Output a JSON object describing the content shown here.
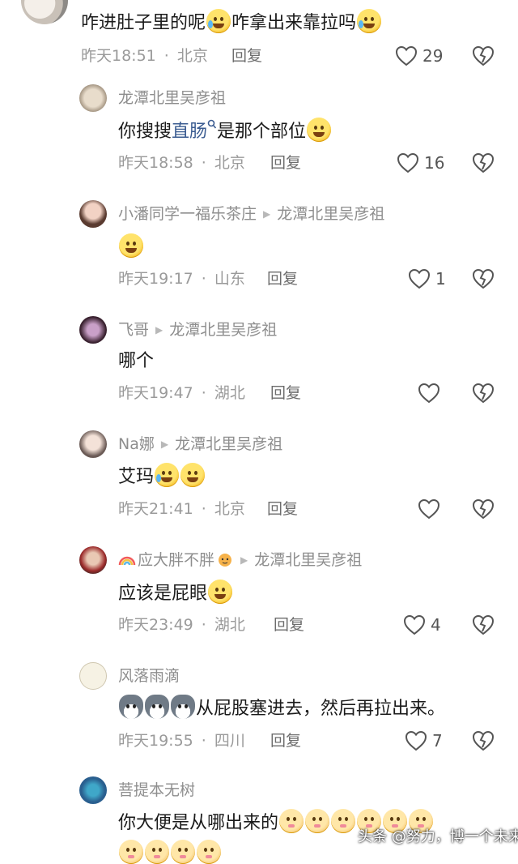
{
  "top_comment": {
    "text_a": "咋进肚子里的呢",
    "text_b": "咋拿出来靠拉吗",
    "time": "昨天18:51",
    "location": "北京",
    "reply_label": "回复",
    "likes": "29"
  },
  "replies": [
    {
      "name": "龙潭北里吴彦祖",
      "reply_to": "",
      "text_a": "你搜搜",
      "link": "直肠",
      "text_b": "是那个部位",
      "time": "昨天18:58",
      "location": "北京",
      "reply_label": "回复",
      "likes": "16"
    },
    {
      "name": "小潘同学一福乐茶庄",
      "reply_to": "龙潭北里吴彦祖",
      "time": "昨天19:17",
      "location": "山东",
      "reply_label": "回复",
      "likes": "1"
    },
    {
      "name": "飞哥",
      "reply_to": "龙潭北里吴彦祖",
      "text": "哪个",
      "time": "昨天19:47",
      "location": "湖北",
      "reply_label": "回复",
      "likes": ""
    },
    {
      "name": "Na娜",
      "reply_to": "龙潭北里吴彦祖",
      "text": "艾玛",
      "time": "昨天21:41",
      "location": "北京",
      "reply_label": "回复",
      "likes": ""
    },
    {
      "name": "应大胖不胖",
      "reply_to": "龙潭北里吴彦祖",
      "text": "应该是屁眼",
      "time": "昨天23:49",
      "location": "湖北",
      "reply_label": "回复",
      "likes": "4"
    },
    {
      "name": "风落雨滴",
      "reply_to": "",
      "text": "从屁股塞进去，然后再拉出来。",
      "time": "昨天19:55",
      "location": "四川",
      "reply_label": "回复",
      "likes": "7"
    },
    {
      "name": "菩提本无树",
      "reply_to": "",
      "text": "你大便是从哪出来的",
      "time": "",
      "location": "",
      "reply_label": "",
      "likes": ""
    }
  ],
  "watermark": "头条 @努力，博一个未来",
  "icons": {
    "like": "heart-outline-icon",
    "dislike": "broken-heart-icon",
    "reply_arrow": "play-arrow-icon",
    "search": "search-icon"
  },
  "colors": {
    "text": "#1b1b1b",
    "meta": "#9a9a9a",
    "link": "#3b5c91"
  }
}
